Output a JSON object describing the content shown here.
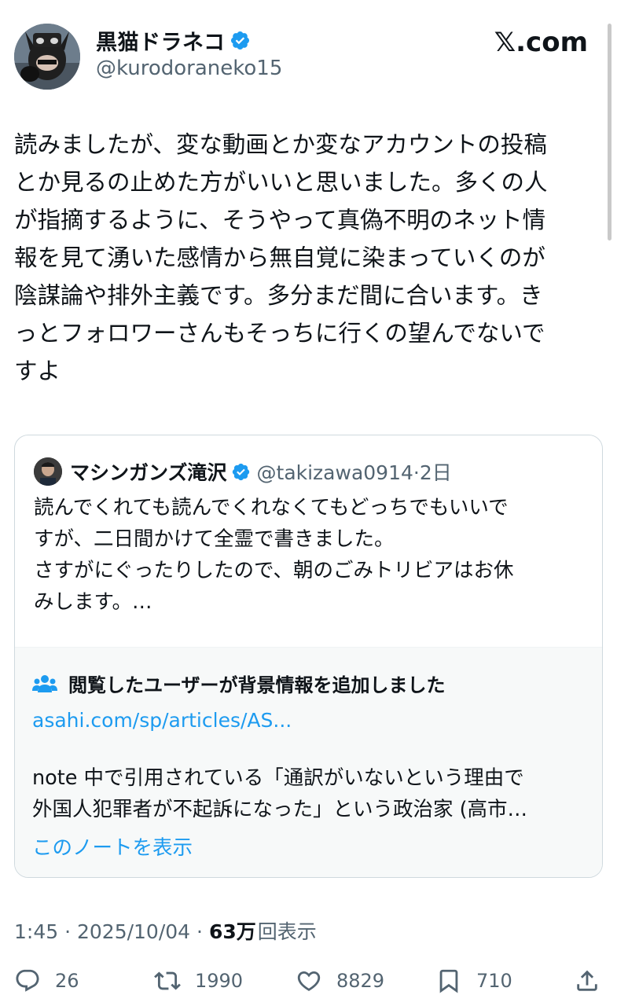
{
  "author": {
    "display_name": "黒猫ドラネコ",
    "handle": "@kurodoraneko15",
    "verified": true
  },
  "site_label": "𝕏.com",
  "tweet_text": "読みましたが、変な動画とか変なアカウントの投稿\nとか見るの止めた方がいいと思いました。多くの人\nが指摘するように、そうやって真偽不明のネット情\n報を見て湧いた感情から無自覚に染まっていくのが\n陰謀論や排外主義です。多分まだ間に合います。き\nっとフォロワーさんもそっちに行くの望んでないで\nすよ",
  "quoted": {
    "display_name": "マシンガンズ滝沢",
    "handle_time": "@takizawa0914·2日",
    "text": "読んでくれても読んでくれなくてもどっちでもいいで\nすが、二日間かけて全霊で書きました。\nさすがにぐったりしたので、朝のごみトリビアはお休\nみします。…",
    "note": {
      "title": "閲覧したユーザーが背景情報を追加しました",
      "link": "asahi.com/sp/articles/AS...",
      "text": "note 中で引用されている「通訳がいないという理由で\n外国人犯罪者が不起訴になった」という政治家 (高市…",
      "show_label": "このノートを表示"
    }
  },
  "meta": {
    "time_date": "1:45 · 2025/10/04 ·",
    "views_num": "63万",
    "views_label": "回表示"
  },
  "actions": {
    "replies": "26",
    "reposts": "1990",
    "likes": "8829",
    "bookmarks": "710"
  },
  "colors": {
    "accent": "#1d9bf0",
    "text": "#0f1419",
    "secondary": "#536471",
    "border": "#cfd9de"
  }
}
